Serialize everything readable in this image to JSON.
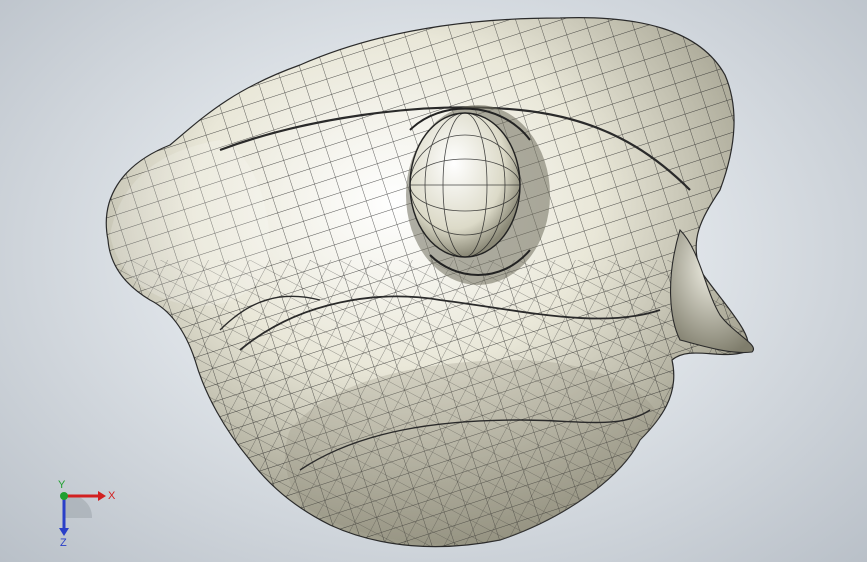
{
  "viewport": {
    "model_name": "mesh-surface-model",
    "colors": {
      "background_center": "#f4f6f8",
      "background_edge": "#b9c0c8",
      "surface": "#e6e4d4",
      "surface_shadow": "#9c9a88",
      "wire": "#1d1d1d"
    }
  },
  "triad": {
    "x_label": "X",
    "y_label": "Y",
    "z_label": "Z",
    "x_color": "#d22020",
    "y_color": "#20a030",
    "z_color": "#2a3fc8"
  }
}
